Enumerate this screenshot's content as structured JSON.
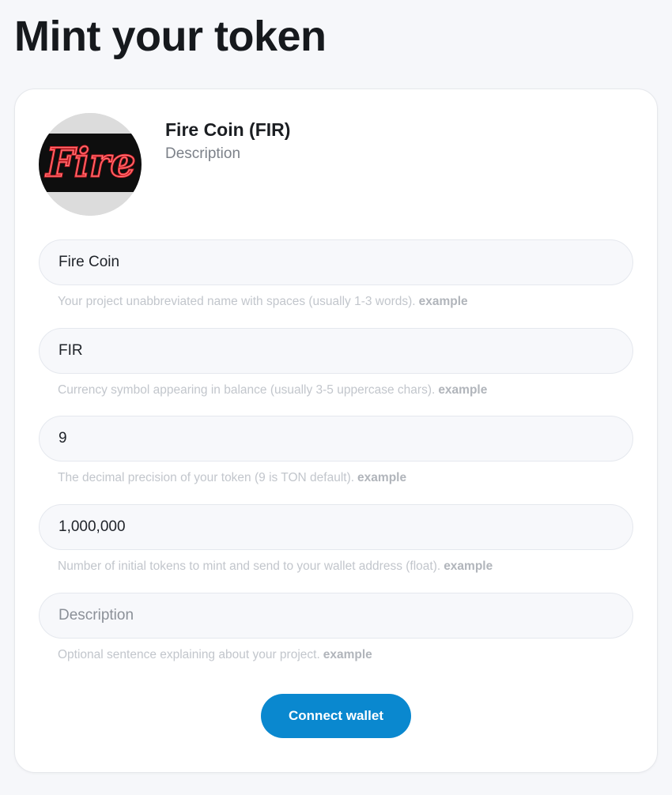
{
  "page": {
    "title": "Mint your token"
  },
  "token": {
    "name": "Fire Coin (FIR)",
    "description": "Description",
    "logo_text": "Fire",
    "logo_icon": "neon-fire-sign"
  },
  "fields": [
    {
      "value": "Fire Coin",
      "placeholder": "",
      "help": "Your project unabbreviated name with spaces (usually 1-3 words).",
      "example": "example"
    },
    {
      "value": "FIR",
      "placeholder": "",
      "help": "Currency symbol appearing in balance (usually 3-5 uppercase chars).",
      "example": "example"
    },
    {
      "value": "9",
      "placeholder": "",
      "help": "The decimal precision of your token (9 is TON default).",
      "example": "example"
    },
    {
      "value": "1,000,000",
      "placeholder": "",
      "help": "Number of initial tokens to mint and send to your wallet address (float).",
      "example": "example"
    },
    {
      "value": "",
      "placeholder": "Description",
      "help": "Optional sentence explaining about your project.",
      "example": "example"
    }
  ],
  "actions": {
    "connect_label": "Connect wallet"
  },
  "colors": {
    "primary_button": "#0a88cf",
    "page_background": "#f6f7fa",
    "help_text": "#c2c6cc",
    "logo_red": "#e0242c"
  }
}
